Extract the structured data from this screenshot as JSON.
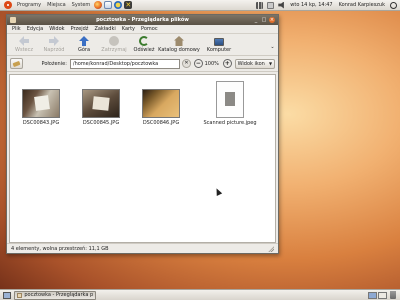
{
  "top_panel": {
    "menus": [
      "Programy",
      "Miejsca",
      "System"
    ],
    "clock": "wto 14 kp, 14:47",
    "user": "Konrad Karpieszuk"
  },
  "window": {
    "title": "pocztowka - Przeglądarka plików",
    "menu": [
      "Plik",
      "Edycja",
      "Widok",
      "Przejdź",
      "Zakładki",
      "Karty",
      "Pomoc"
    ],
    "toolbar": {
      "back": "Wstecz",
      "forward": "Naprzód",
      "up": "Góra",
      "stop": "Zatrzymaj",
      "reload": "Odśwież",
      "home": "Katalog domowy",
      "computer": "Komputer"
    },
    "location": {
      "label": "Położenie:",
      "value": "/home/konrad/Desktop/pocztowka",
      "zoom_out": "−",
      "zoom": "100%",
      "zoom_in": "+",
      "view_mode": "Widok ikon"
    },
    "files": [
      {
        "name": "DSC00843.JPG"
      },
      {
        "name": "DSC00845.JPG"
      },
      {
        "name": "DSC00846.JPG"
      },
      {
        "name": "Scanned picture.jpeg"
      }
    ],
    "status": "4 elementy, wolna przestrzeń: 11,1 GB"
  },
  "bottom_panel": {
    "task": "pocztowka - Przeglądarka plików"
  },
  "colors": {
    "titlebar": "#5a5246",
    "accent": "#dd4814",
    "panel": "#dcd8d0"
  }
}
